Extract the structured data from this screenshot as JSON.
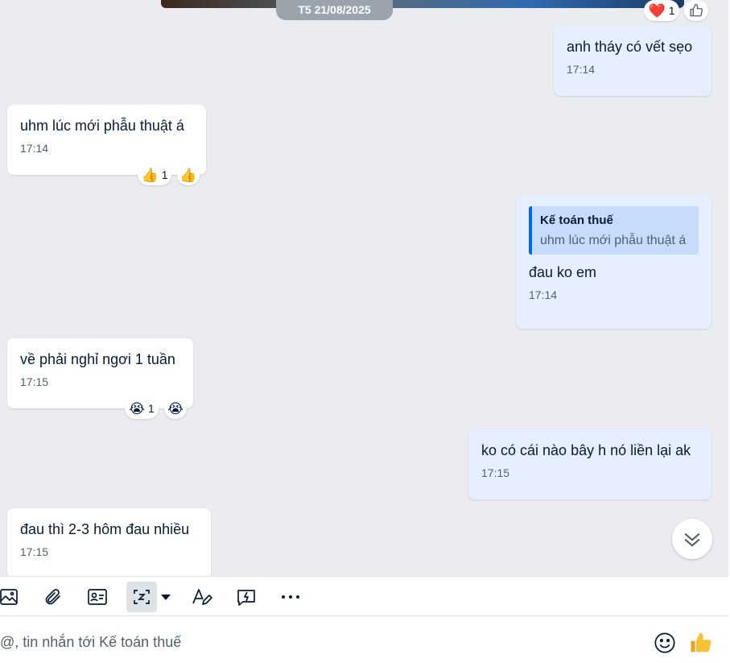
{
  "date_separator": "T5 21/08/2025",
  "messages": [
    {
      "direction": "out",
      "text": "anh tháy có vết sẹo",
      "time": "17:14"
    },
    {
      "direction": "in",
      "text": "uhm lúc mới phẫu thuật á",
      "time": "17:14",
      "reaction": {
        "emoji": "👍",
        "count": "1"
      }
    },
    {
      "direction": "out",
      "quote": {
        "name": "Kế toán thuế",
        "text": "uhm lúc mới phẫu thuật á"
      },
      "text": "đau ko em",
      "time": "17:14"
    },
    {
      "direction": "in",
      "text": "về phải nghỉ ngơi 1 tuần",
      "time": "17:15",
      "reaction": {
        "emoji": "😭",
        "count": "1"
      }
    },
    {
      "direction": "out",
      "text": "ko có cái nào bây h nó liền lại ak",
      "time": "17:15"
    },
    {
      "direction": "in",
      "text": "đau thì 2-3 hôm đau nhiều",
      "time": "17:15"
    }
  ],
  "top_reaction": {
    "emoji": "❤️",
    "count": "1"
  },
  "toolbar": {
    "icons": [
      "image-icon",
      "attachment-icon",
      "contact-card-icon",
      "screenshot-icon",
      "format-text-icon",
      "quick-message-icon",
      "more-icon"
    ]
  },
  "composer": {
    "placeholder": "@, tin nhắn tới Kế toán thuế"
  },
  "colors": {
    "accent": "#0068ff",
    "outgoing_bubble": "#e5efff",
    "background": "#ebecf0",
    "quote_bg": "#c7dcfc"
  }
}
